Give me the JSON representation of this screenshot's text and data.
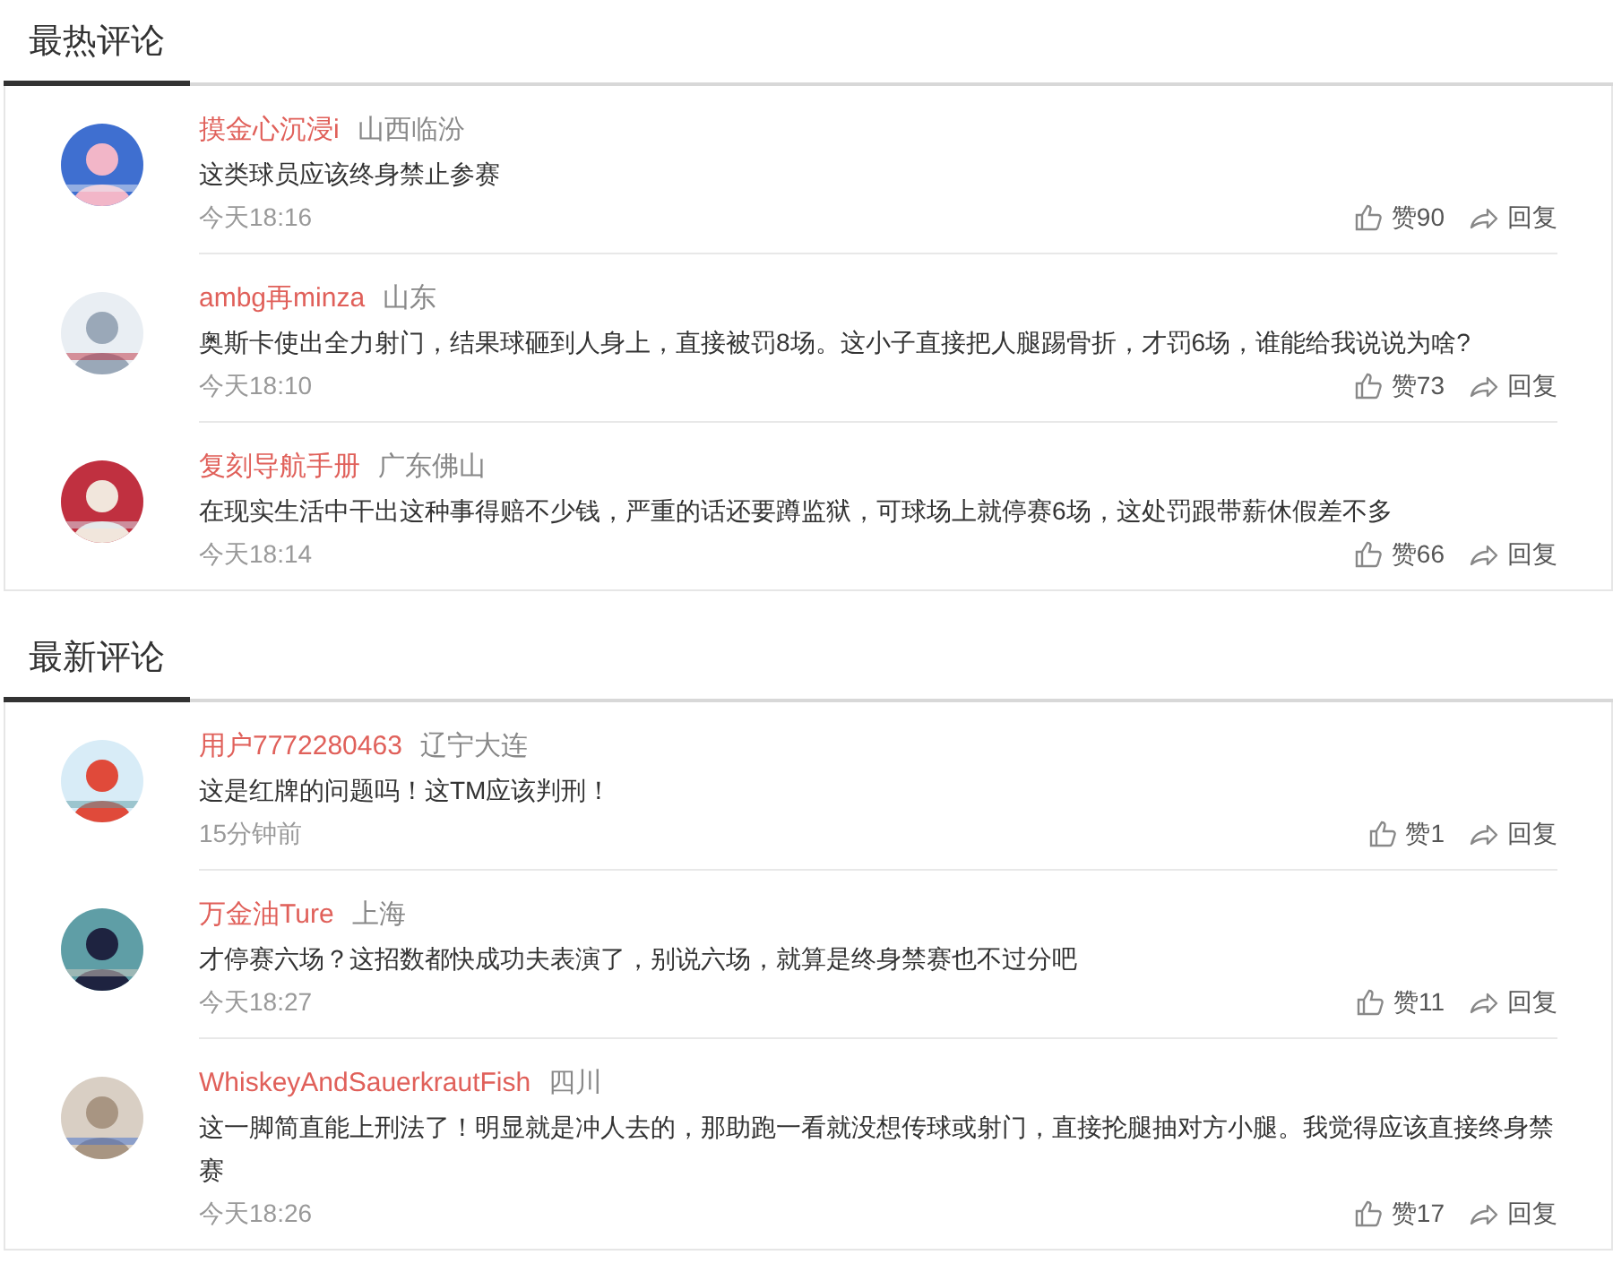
{
  "sections": [
    {
      "title": "最热评论",
      "comments": [
        {
          "user": "摸金心沉浸i",
          "location": "山西临汾",
          "text": "这类球员应该终身禁止参赛",
          "time": "今天18:16",
          "likes": "赞90",
          "reply": "回复"
        },
        {
          "user": "ambg再minza",
          "location": "山东",
          "text": "奥斯卡使出全力射门，结果球砸到人身上，直接被罚8场。这小子直接把人腿踢骨折，才罚6场，谁能给我说说为啥?",
          "time": "今天18:10",
          "likes": "赞73",
          "reply": "回复"
        },
        {
          "user": "复刻导航手册",
          "location": "广东佛山",
          "text": "在现实生活中干出这种事得赔不少钱，严重的话还要蹲监狱，可球场上就停赛6场，这处罚跟带薪休假差不多",
          "time": "今天18:14",
          "likes": "赞66",
          "reply": "回复"
        }
      ]
    },
    {
      "title": "最新评论",
      "comments": [
        {
          "user": "用户7772280463",
          "location": "辽宁大连",
          "text": "这是红牌的问题吗！这TM应该判刑！",
          "time": "15分钟前",
          "likes": "赞1",
          "reply": "回复"
        },
        {
          "user": "万金油Ture",
          "location": "上海",
          "text": "才停赛六场？这招数都快成功夫表演了，别说六场，就算是终身禁赛也不过分吧",
          "time": "今天18:27",
          "likes": "赞11",
          "reply": "回复"
        },
        {
          "user": "WhiskeyAndSauerkrautFish",
          "location": "四川",
          "text": "这一脚简直能上刑法了！明显就是冲人去的，那助跑一看就没想传球或射门，直接抡腿抽对方小腿。我觉得应该直接终身禁赛",
          "time": "今天18:26",
          "likes": "赞17",
          "reply": "回复"
        }
      ]
    }
  ]
}
